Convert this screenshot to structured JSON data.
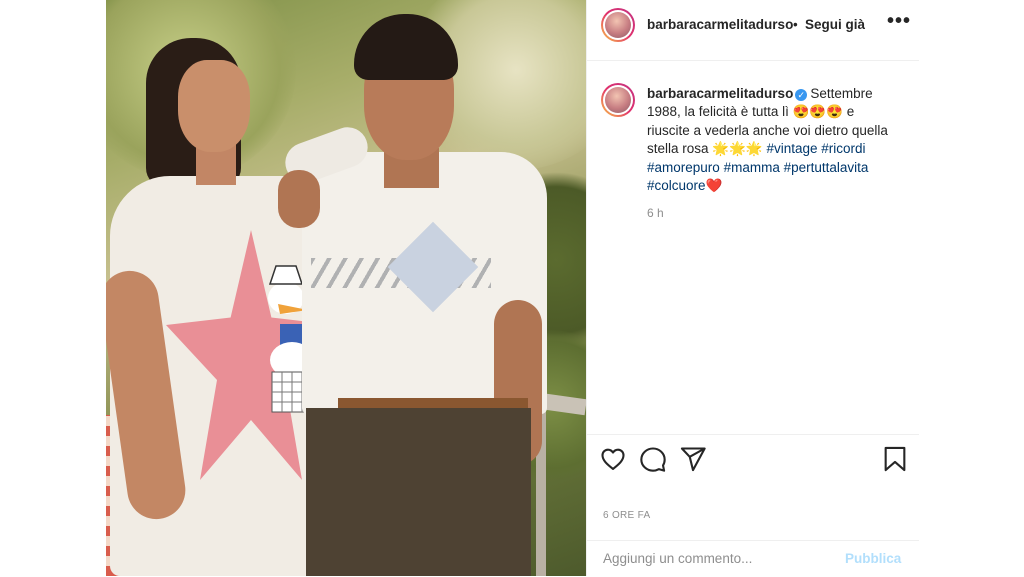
{
  "post": {
    "photo_alt": "",
    "header": {
      "username": "barbaracarmelitadurso",
      "separator": "•",
      "follow_label": "Segui già",
      "more_icon": "more-horizontal-icon",
      "more_glyph": "•••"
    },
    "caption": {
      "username": "barbaracarmelitadurso",
      "verified_icon": "verified-badge-icon",
      "verified_glyph": "✓",
      "text_part1": "Settembre 1988, la felicità è tutta lì ",
      "emoji_1": "😍😍😍",
      "text_part2": " e riuscite a vederla anche voi dietro quella stella rosa ",
      "emoji_2": "🌟🌟🌟",
      "hashtags": [
        "#vintage",
        "#ricordi",
        "#amorepuro",
        "#mamma",
        "#pertuttalavita",
        "#colcuore"
      ],
      "emoji_3": "❤️",
      "time": "6 h"
    },
    "actions": {
      "like_icon": "heart-icon",
      "comment_icon": "comment-icon",
      "share_icon": "paper-plane-icon",
      "save_icon": "bookmark-icon"
    },
    "posted_ago": "6 ORE FA",
    "comment": {
      "placeholder": "Aggiungi un commento...",
      "publish_label": "Pubblica"
    }
  },
  "colors": {
    "text": "#262626",
    "secondary": "#8e8e8e",
    "hashtag": "#00376b",
    "publish_disabled": "#b2dffc",
    "verified": "#3897f0",
    "divider": "#efefef"
  }
}
